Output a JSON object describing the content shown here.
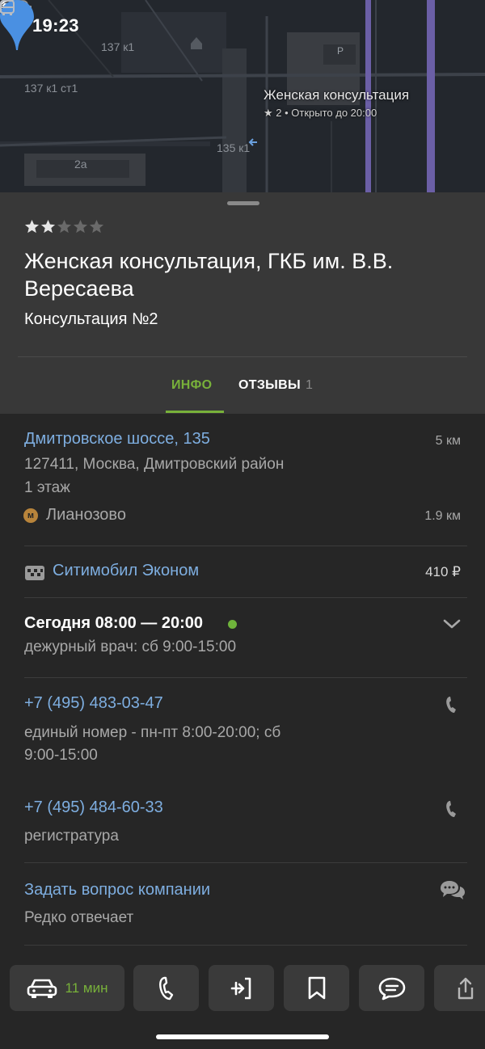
{
  "status_bar": {
    "time": "19:23"
  },
  "map": {
    "labels": [
      "137 к1",
      "137 к1 ст1",
      "135 к1",
      "2а"
    ],
    "pin_title": "Женская консультация",
    "pin_subtitle": "★ 2 • Открыто до 20:00",
    "parking_letter": "P"
  },
  "header": {
    "rating_stars": 2,
    "rating_max": 5,
    "title": "Женская консультация, ГКБ им. В.В. Вересаева",
    "subtitle": "Консультация №2"
  },
  "tabs": [
    {
      "label": "ИНФО",
      "active": true
    },
    {
      "label": "ОТЗЫВЫ",
      "count": "1",
      "active": false
    }
  ],
  "address": {
    "street": "Дмитровское шоссе, 135",
    "distance": "5 км",
    "line2": "127411, Москва, Дмитровский район",
    "line3": "1 этаж"
  },
  "metro": {
    "icon_letter": "м",
    "name": "Лианозово",
    "distance": "1.9 км"
  },
  "taxi": {
    "name": "Ситимобил Эконом",
    "price": "410 ₽"
  },
  "hours": {
    "today": "Сегодня 08:00 — 20:00",
    "note": "дежурный врач: сб 9:00-15:00"
  },
  "phones": [
    {
      "number": "+7 (495) 483-03-47",
      "note_line1": "единый номер - пн-пт 8:00-20:00; сб",
      "note_line2": "9:00-15:00"
    },
    {
      "number": "+7 (495) 484-60-33",
      "note": "регистратура"
    }
  ],
  "ask": {
    "label": "Задать вопрос компании",
    "note": "Редко отвечает"
  },
  "bottom_bar": {
    "route_time": "11 мин"
  },
  "colors": {
    "accent_green": "#78b13a",
    "link_blue": "#7eaee0",
    "pin_blue": "#4a90e2"
  }
}
